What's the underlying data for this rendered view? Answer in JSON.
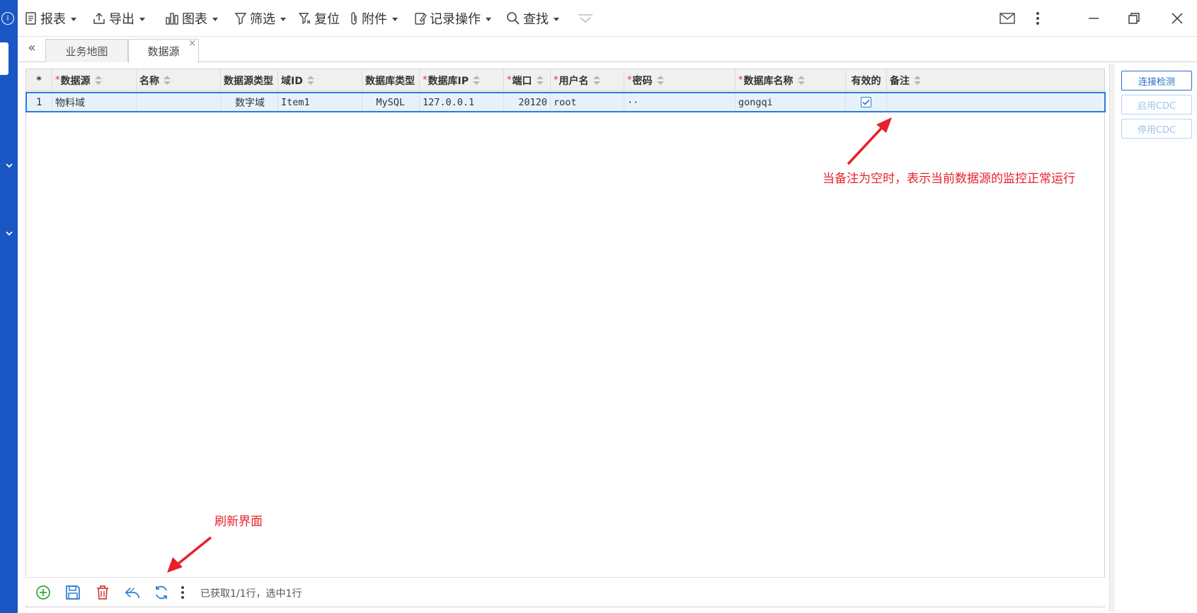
{
  "toolbar": {
    "items": [
      {
        "label": "报表",
        "icon": "report-icon",
        "dropdown": true
      },
      {
        "label": "导出",
        "icon": "export-icon",
        "dropdown": true
      },
      {
        "label": "图表",
        "icon": "chart-icon",
        "dropdown": true
      },
      {
        "label": "筛选",
        "icon": "filter-icon",
        "dropdown": true
      },
      {
        "label": "复位",
        "icon": "filter-reset-icon",
        "dropdown": false
      },
      {
        "label": "附件",
        "icon": "attachment-icon",
        "dropdown": true
      },
      {
        "label": "记录操作",
        "icon": "record-ops-icon",
        "dropdown": true
      },
      {
        "label": "查找",
        "icon": "search-icon",
        "dropdown": true
      }
    ]
  },
  "tabs": [
    {
      "label": "业务地图",
      "active": false
    },
    {
      "label": "数据源",
      "active": true,
      "closable": true
    }
  ],
  "tab_collapse": "«",
  "tab_close": "×",
  "grid": {
    "row_number_header": "*",
    "columns": [
      {
        "label": "数据源",
        "required": true,
        "sortable": true
      },
      {
        "label": "名称",
        "required": false,
        "sortable": true
      },
      {
        "label": "数据源类型",
        "required": false,
        "sortable": false
      },
      {
        "label": "域ID",
        "required": false,
        "sortable": true
      },
      {
        "label": "数据库类型",
        "required": false,
        "sortable": false
      },
      {
        "label": "数据库IP",
        "required": true,
        "sortable": true
      },
      {
        "label": "端口",
        "required": true,
        "sortable": true
      },
      {
        "label": "用户名",
        "required": true,
        "sortable": true
      },
      {
        "label": "密码",
        "required": true,
        "sortable": true
      },
      {
        "label": "数据库名称",
        "required": true,
        "sortable": true
      },
      {
        "label": "有效的",
        "required": false,
        "sortable": false
      },
      {
        "label": "备注",
        "required": false,
        "sortable": true
      }
    ],
    "required_mark": "*",
    "rows": [
      {
        "num": "1",
        "cells": [
          "物料域",
          "",
          "数字域",
          "Item1",
          "MySQL",
          "127.0.0.1",
          "20120",
          "root",
          "··",
          "gongqi",
          "",
          ""
        ],
        "valid_checked": true,
        "selected": true
      }
    ]
  },
  "bottom_bar": {
    "buttons": [
      "add-icon",
      "save-icon",
      "delete-icon",
      "undo-icon",
      "refresh-icon",
      "more-icon"
    ],
    "status": "已获取1/1行，选中1行"
  },
  "right_panel": {
    "buttons": [
      {
        "label": "连接检测",
        "enabled": true
      },
      {
        "label": "启用CDC",
        "enabled": false
      },
      {
        "label": "停用CDC",
        "enabled": false
      }
    ]
  },
  "annotations": {
    "remark_note": "当备注为空时，表示当前数据源的监控正常运行",
    "refresh_note": "刷新界面"
  },
  "colors": {
    "accent": "#2c7bd6",
    "left_strip": "#1a56c4",
    "annotation": "#e8202a",
    "required": "#e03030"
  }
}
